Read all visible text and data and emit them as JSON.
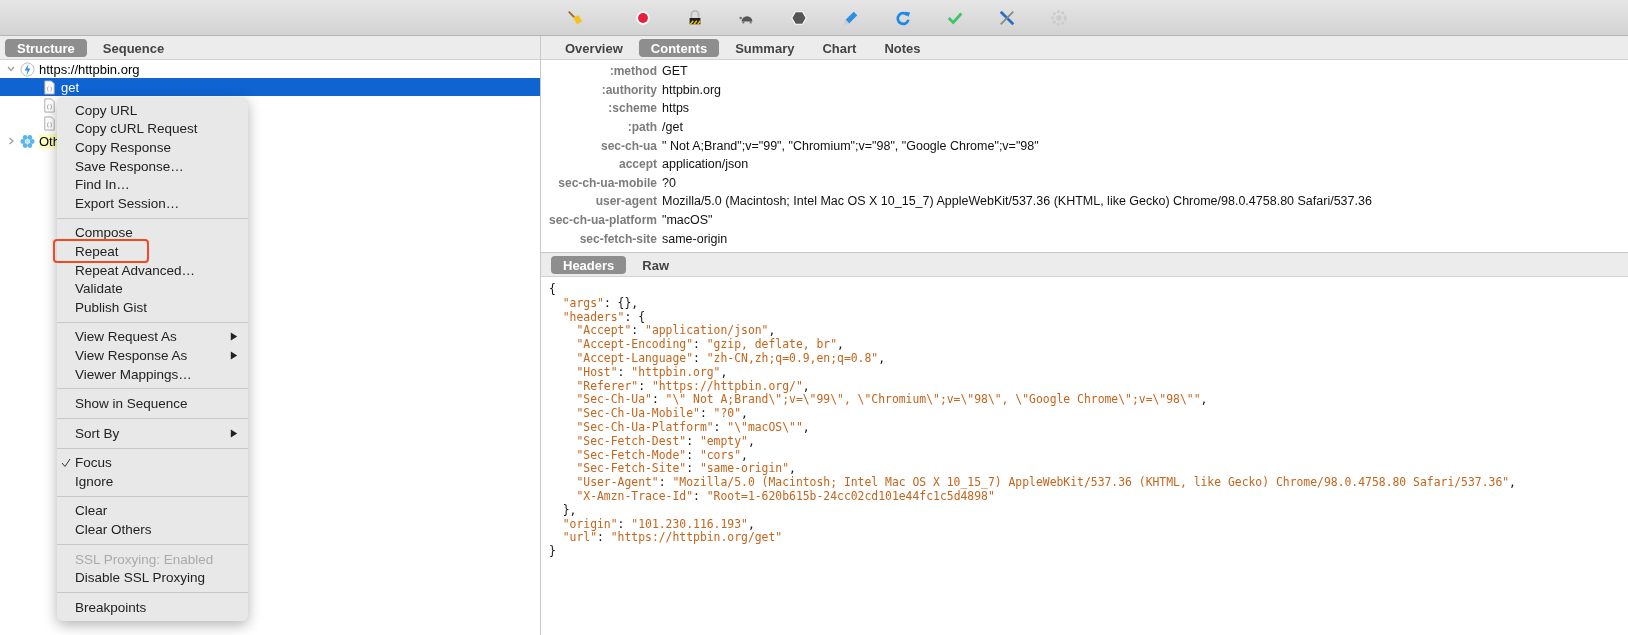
{
  "left_tabs": [
    {
      "label": "Structure",
      "selected": true
    },
    {
      "label": "Sequence",
      "selected": false
    }
  ],
  "tree": [
    {
      "label": "https://httpbin.org",
      "kind": "host",
      "expanded": true,
      "selected": false,
      "children": [
        {
          "label": "get",
          "selected": true
        },
        {
          "selected": false
        },
        {
          "selected": false
        }
      ]
    },
    {
      "label": "Oth",
      "kind": "group",
      "expanded": false,
      "selected": false
    }
  ],
  "context_menu": {
    "groups": [
      [
        {
          "label": "Copy URL"
        },
        {
          "label": "Copy cURL Request"
        },
        {
          "label": "Copy Response"
        },
        {
          "label": "Save Response…"
        },
        {
          "label": "Find In…"
        },
        {
          "label": "Export Session…"
        }
      ],
      [
        {
          "label": "Compose"
        },
        {
          "label": "Repeat",
          "annotated": true
        },
        {
          "label": "Repeat Advanced…"
        },
        {
          "label": "Validate"
        },
        {
          "label": "Publish Gist"
        }
      ],
      [
        {
          "label": "View Request As",
          "submenu": true
        },
        {
          "label": "View Response As",
          "submenu": true
        },
        {
          "label": "Viewer Mappings…"
        }
      ],
      [
        {
          "label": "Show in Sequence"
        }
      ],
      [
        {
          "label": "Sort By",
          "submenu": true
        }
      ],
      [
        {
          "label": "Focus",
          "checked": true
        },
        {
          "label": "Ignore",
          "checked": false
        }
      ],
      [
        {
          "label": "Clear"
        },
        {
          "label": "Clear Others"
        }
      ],
      [
        {
          "label": "SSL Proxying: Enabled",
          "disabled": true
        },
        {
          "label": "Disable SSL Proxying"
        }
      ],
      [
        {
          "label": "Breakpoints"
        }
      ]
    ]
  },
  "right_tabs": [
    {
      "label": "Overview",
      "selected": false
    },
    {
      "label": "Contents",
      "selected": true
    },
    {
      "label": "Summary",
      "selected": false
    },
    {
      "label": "Chart",
      "selected": false
    },
    {
      "label": "Notes",
      "selected": false
    }
  ],
  "request_headers": [
    {
      "name": ":method",
      "value": "GET"
    },
    {
      "name": ":authority",
      "value": "httpbin.org"
    },
    {
      "name": ":scheme",
      "value": "https"
    },
    {
      "name": ":path",
      "value": "/get"
    },
    {
      "name": "sec-ch-ua",
      "value": "\" Not A;Brand\";v=\"99\", \"Chromium\";v=\"98\", \"Google Chrome\";v=\"98\""
    },
    {
      "name": "accept",
      "value": "application/json"
    },
    {
      "name": "sec-ch-ua-mobile",
      "value": "?0"
    },
    {
      "name": "user-agent",
      "value": "Mozilla/5.0 (Macintosh; Intel Mac OS X 10_15_7) AppleWebKit/537.36 (KHTML, like Gecko) Chrome/98.0.4758.80 Safari/537.36"
    },
    {
      "name": "sec-ch-ua-platform",
      "value": "\"macOS\""
    },
    {
      "name": "sec-fetch-site",
      "value": "same-origin"
    }
  ],
  "response_tabs": [
    {
      "label": "Headers",
      "selected": true
    },
    {
      "label": "Raw",
      "selected": false
    }
  ],
  "response_body": [
    "{",
    "  \"args\": {},",
    "  \"headers\": {",
    "    \"Accept\": \"application/json\",",
    "    \"Accept-Encoding\": \"gzip, deflate, br\",",
    "    \"Accept-Language\": \"zh-CN,zh;q=0.9,en;q=0.8\",",
    "    \"Host\": \"httpbin.org\",",
    "    \"Referer\": \"https://httpbin.org/\",",
    "    \"Sec-Ch-Ua\": \"\\\" Not A;Brand\\\";v=\\\"99\\\", \\\"Chromium\\\";v=\\\"98\\\", \\\"Google Chrome\\\";v=\\\"98\\\"\",",
    "    \"Sec-Ch-Ua-Mobile\": \"?0\",",
    "    \"Sec-Ch-Ua-Platform\": \"\\\"macOS\\\"\",",
    "    \"Sec-Fetch-Dest\": \"empty\",",
    "    \"Sec-Fetch-Mode\": \"cors\",",
    "    \"Sec-Fetch-Site\": \"same-origin\",",
    "    \"User-Agent\": \"Mozilla/5.0 (Macintosh; Intel Mac OS X 10_15_7) AppleWebKit/537.36 (KHTML, like Gecko) Chrome/98.0.4758.80 Safari/537.36\",",
    "    \"X-Amzn-Trace-Id\": \"Root=1-620b615b-24cc02cd101e44fc1c5d4898\"",
    "  },",
    "  \"origin\": \"101.230.116.193\",",
    "  \"url\": \"https://httpbin.org/get\"",
    "}"
  ]
}
